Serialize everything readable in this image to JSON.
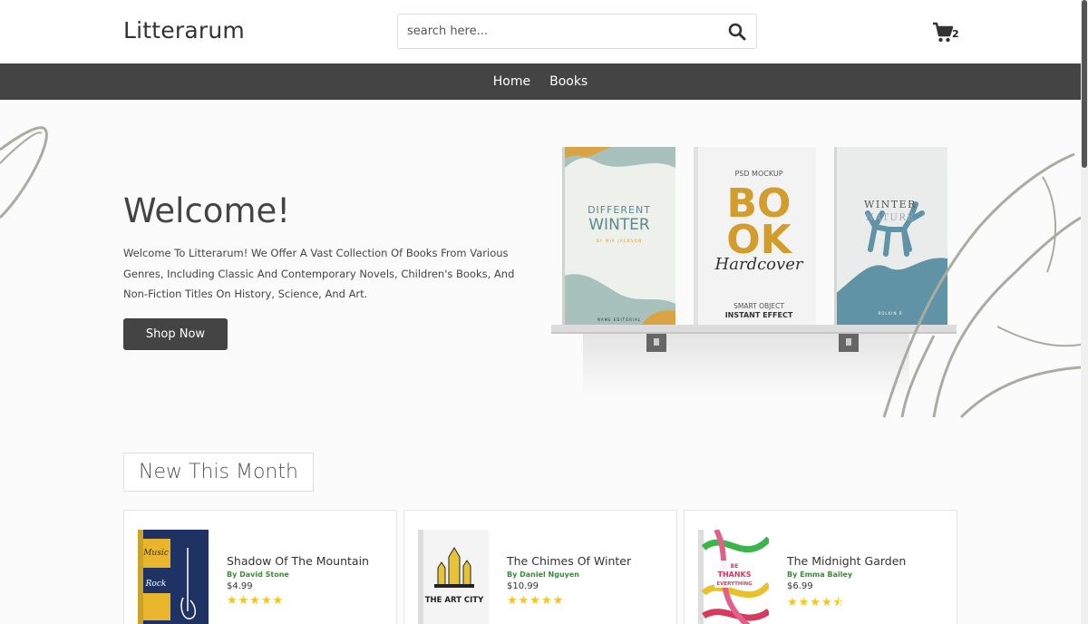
{
  "header": {
    "logo": "Litterarum",
    "search_placeholder": "search here...",
    "cart_count": "2"
  },
  "nav": {
    "items": [
      "Home",
      "Books"
    ]
  },
  "hero": {
    "title": "Welcome!",
    "text": "Welcome To Litterarum! We Offer A Vast Collection Of Books From Various Genres, Including Classic And Contemporary Novels, Children's Books, And Non-Fiction Titles On History, Science, And Art.",
    "button": "Shop Now",
    "books": {
      "left": {
        "line1": "DIFFERENT",
        "line2": "WINTER",
        "author": "BY MIA JACKSON",
        "footer": "NAME EDITORIAL"
      },
      "middle": {
        "top": "PSD MOCKUP",
        "big1": "BO",
        "big2": "OK",
        "script": "Hardcover",
        "sub1": "SMART OBJECT",
        "sub2": "INSTANT EFFECT"
      },
      "right": {
        "line1": "WINTER",
        "line2": "NATURE",
        "footer": "ROLKIN.R"
      }
    }
  },
  "section": {
    "title": "New This Month"
  },
  "products": [
    {
      "title": "Shadow Of The Mountain",
      "author": "By David Stone",
      "price": "$4.99",
      "stars": "★★★★★",
      "rating": 5,
      "cover_text1": "Music",
      "cover_text2": "Rock"
    },
    {
      "title": "The Chimes Of Winter",
      "author": "By Daniel Nguyen",
      "price": "$10.99",
      "stars": "★★★★★",
      "rating": 5,
      "cover_text1": "THE ART CITY",
      "cover_text2": ""
    },
    {
      "title": "The Midnight Garden",
      "author": "By Emma Bailey",
      "price": "$6.99",
      "stars": "★★★★⯪",
      "rating": 4.5,
      "cover_text1": "BE",
      "cover_text2": "THANKS",
      "cover_text3": "EVERYTHING"
    }
  ],
  "colors": {
    "dark": "#444444",
    "accent_green": "#3a8a3a",
    "star": "#f5c518",
    "sage": "#a9aca1"
  }
}
